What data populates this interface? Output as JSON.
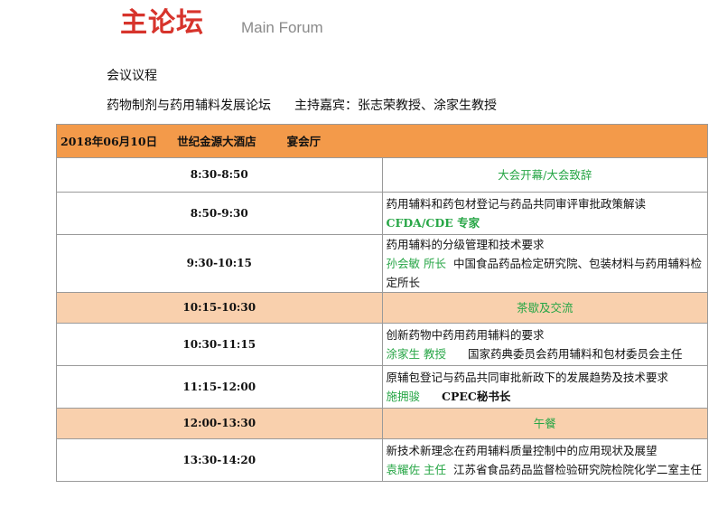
{
  "header": {
    "title_cn": "主论坛",
    "title_en": "Main Forum"
  },
  "agenda_label": "会议议程",
  "forum": {
    "name": "药物制剂与药用辅料发展论坛",
    "host": "主持嘉宾：张志荣教授、涂家生教授"
  },
  "session": {
    "date": "2018年06月10日",
    "venue": "世纪金源大酒店",
    "hall": "宴会厅"
  },
  "schedule": [
    {
      "time": "8:30-8:50",
      "title": "大会开幕/大会致辞"
    },
    {
      "time": "8:50-9:30",
      "topic": "药用辅料和药包材登记与药品共同审评审批政策解读",
      "speaker": "CFDA/CDE 专家",
      "org": ""
    },
    {
      "time": "9:30-10:15",
      "topic": "药用辅料的分级管理和技术要求",
      "speaker": "孙会敏 所长",
      "org": "中国食品药品检定研究院、包装材料与药用辅料检定所长"
    },
    {
      "time": "10:15-10:30",
      "title": "茶歇及交流"
    },
    {
      "time": "10:30-11:15",
      "topic": "创新药物中药用药用辅料的要求",
      "speaker": "涂家生  教授",
      "org": "国家药典委员会药用辅料和包材委员会主任"
    },
    {
      "time": "11:15-12:00",
      "topic": "原辅包登记与药品共同审批新政下的发展趋势及技术要求",
      "speaker": "施拥骏",
      "org": "CPEC秘书长"
    },
    {
      "time": "12:00-13:30",
      "title": "午餐"
    },
    {
      "time": "13:30-14:20",
      "topic": "新技术新理念在药用辅料质量控制中的应用现状及展望",
      "speaker": "袁耀佐 主任",
      "org": "江苏省食品药品监督检验研究院检院化学二室主任"
    }
  ],
  "colors": {
    "title_red": "#d7342c",
    "header_orange": "#f39a4a",
    "break_peach": "#f9d0ad",
    "speaker_green": "#27a646"
  }
}
